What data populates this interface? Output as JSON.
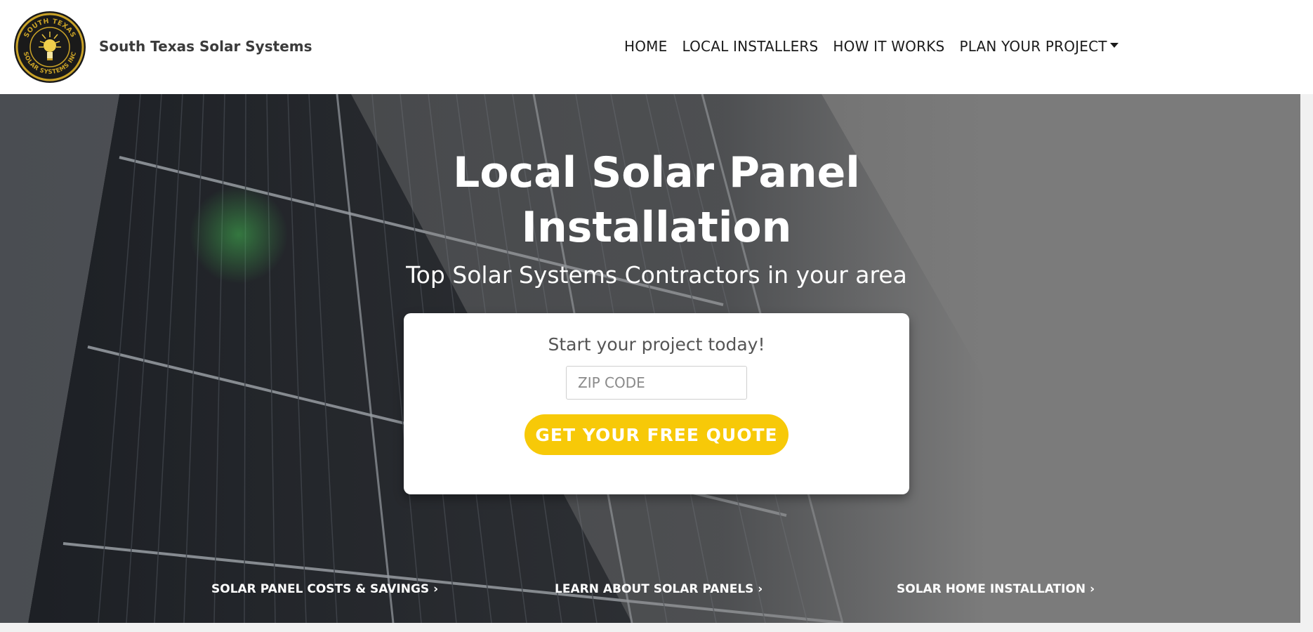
{
  "header": {
    "logo": {
      "top_text": "SOUTH TEXAS",
      "bottom_text": "SOLAR SYSTEMS INC",
      "icon": "sun-bulb-icon"
    },
    "brand_name": "South Texas Solar Systems",
    "nav": [
      {
        "label": "HOME"
      },
      {
        "label": "LOCAL INSTALLERS"
      },
      {
        "label": "HOW IT WORKS"
      },
      {
        "label": "PLAN YOUR PROJECT",
        "icon": "caret-down-icon"
      }
    ]
  },
  "hero": {
    "title_line1": "Local Solar Panel",
    "title_line2": "Installation",
    "subtitle": "Top Solar Systems Contractors in your area",
    "quote": {
      "heading": "Start your project today!",
      "zip_placeholder": "ZIP CODE",
      "zip_value": "",
      "button_label": "GET YOUR FREE QUOTE"
    },
    "links": [
      {
        "label": "SOLAR PANEL COSTS & SAVINGS ›"
      },
      {
        "label": "LEARN ABOUT SOLAR PANELS ›"
      },
      {
        "label": "SOLAR HOME INSTALLATION ›"
      }
    ]
  },
  "colors": {
    "accent": "#f7c908",
    "header_bg": "#ffffff",
    "hero_overlay": "#7b7b7b",
    "text_dark": "#1b1b1b",
    "page_bg": "#f1f1f1"
  }
}
